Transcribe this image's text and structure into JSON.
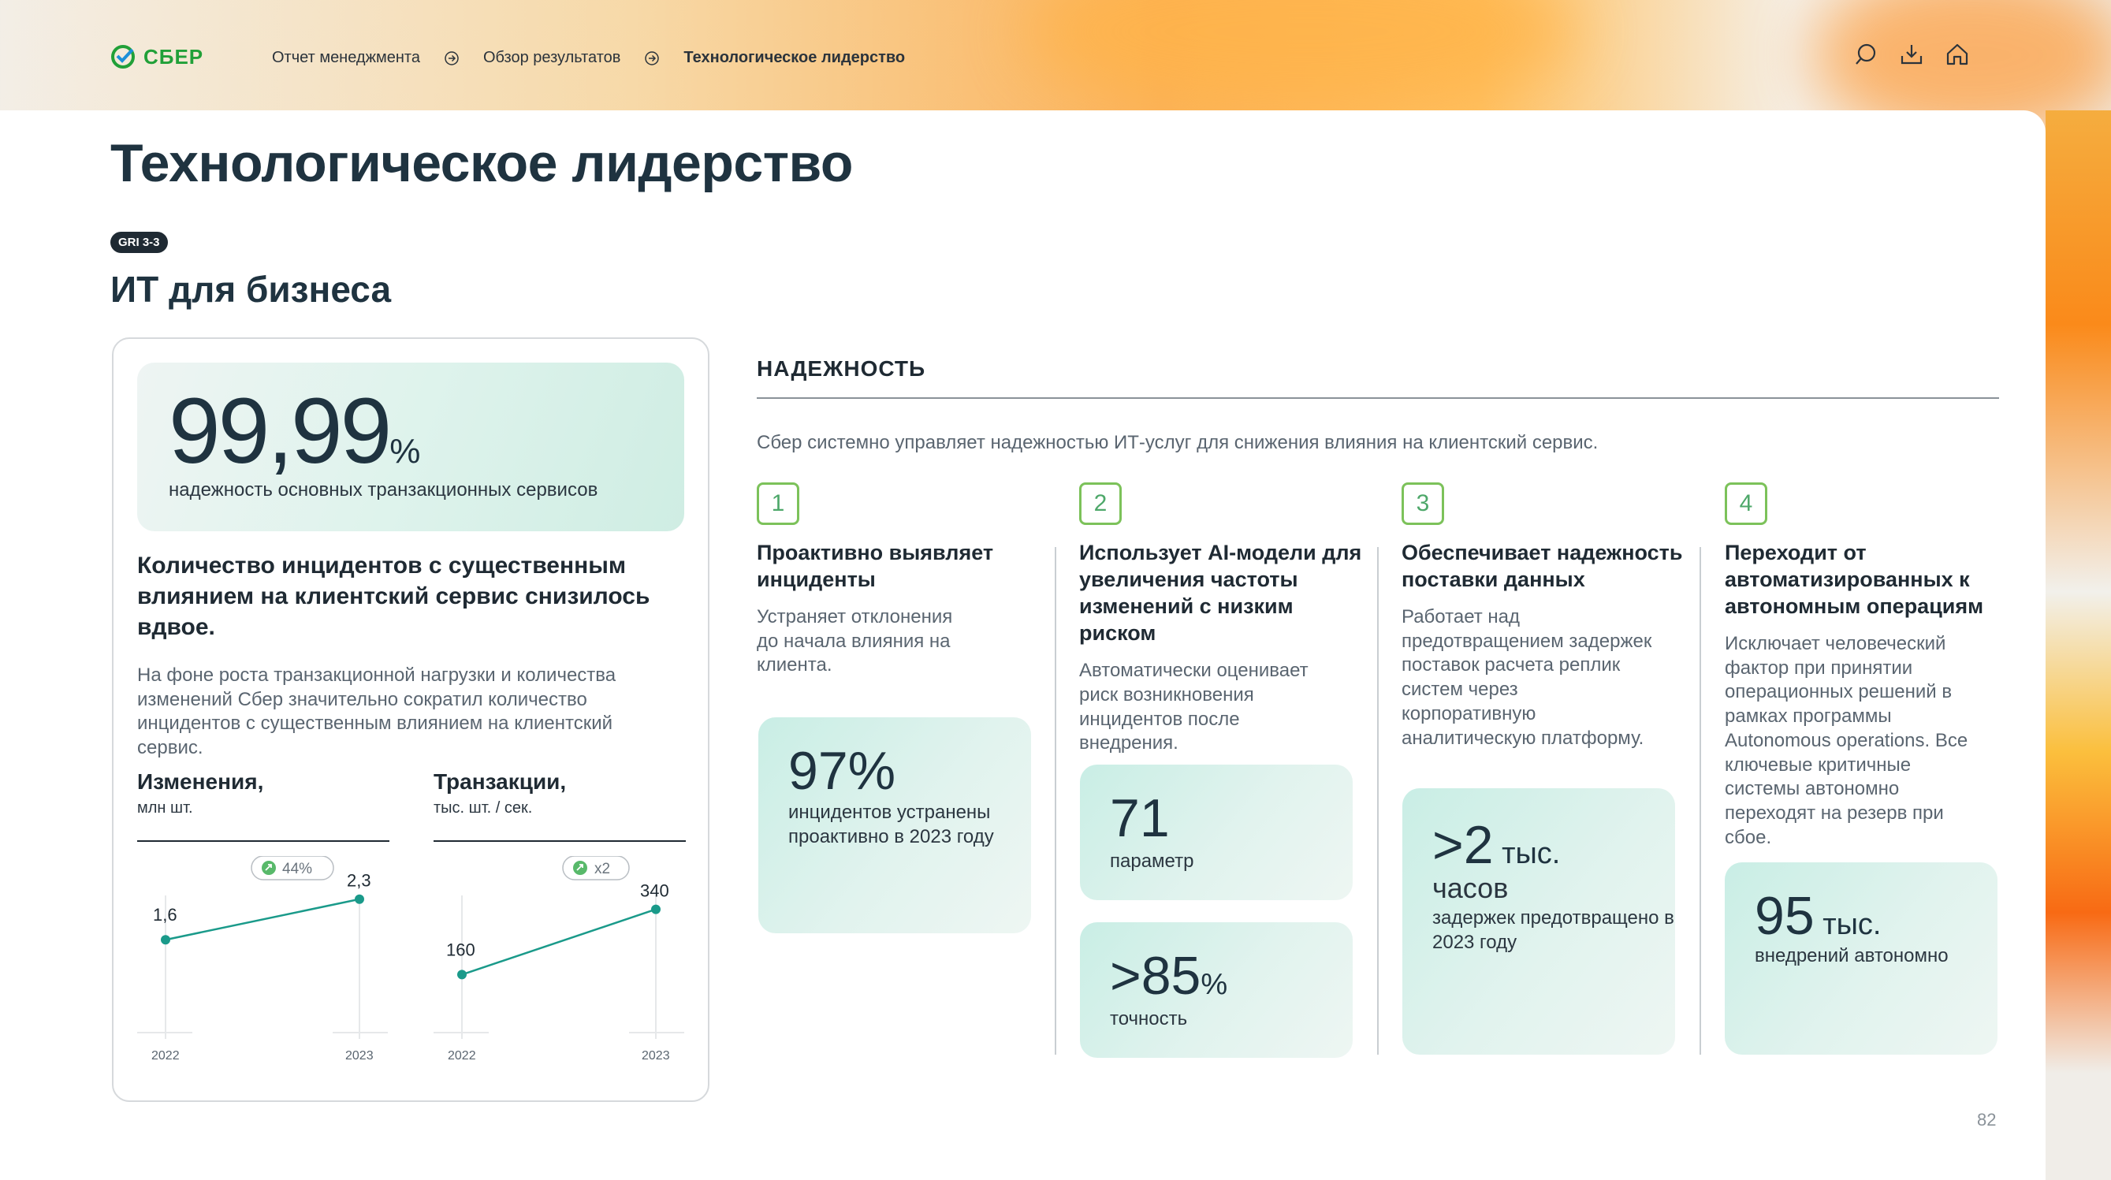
{
  "header": {
    "logo": "СБЕР",
    "breadcrumbs": [
      "Отчет менеджмента",
      "Обзор результатов",
      "Технологическое лидерство"
    ],
    "icons": [
      "search-icon",
      "download-icon",
      "home-icon"
    ]
  },
  "page": {
    "title": "Технологическое лидерство",
    "gri": "GRI 3-3",
    "subtitle": "ИТ для бизнеса",
    "number": "82"
  },
  "left": {
    "hero_value": "99,99",
    "hero_unit": "%",
    "hero_desc": "надежность основных транзакционных сервисов",
    "title": "Количество инцидентов с существенным влиянием на клиентский сервис снизилось вдвое.",
    "text": "На фоне роста транзакционной нагрузки и количества изменений Сбер значительно сократил количество инцидентов с существенным влиянием на клиентский сервис.",
    "charts": [
      {
        "title": "Изменения,",
        "unit": "млн шт.",
        "badge": "44%",
        "years": [
          "2022",
          "2023"
        ],
        "values": [
          "1,6",
          "2,3"
        ]
      },
      {
        "title": "Транзакции,",
        "unit": "тыс. шт. / сек.",
        "badge": "x2",
        "years": [
          "2022",
          "2023"
        ],
        "values": [
          "160",
          "340"
        ]
      }
    ]
  },
  "chart_data": [
    {
      "type": "line",
      "title": "Изменения,",
      "ylabel": "млн шт.",
      "categories": [
        "2022",
        "2023"
      ],
      "values": [
        1.6,
        2.3
      ],
      "annotation": "44%"
    },
    {
      "type": "line",
      "title": "Транзакции,",
      "ylabel": "тыс. шт. / сек.",
      "categories": [
        "2022",
        "2023"
      ],
      "values": [
        160,
        340
      ],
      "annotation": "x2"
    }
  ],
  "reliability": {
    "label": "НАДЕЖНОСТЬ",
    "intro": "Сбер системно управляет надежностью ИТ-услуг для снижения влияния на клиентский сервис.",
    "columns": [
      {
        "n": "1",
        "title": "Проактивно выявляет инциденты",
        "text": "Устраняет отклонения до начала влияния на клиента.",
        "stats": [
          {
            "big": "97%",
            "unit": "",
            "desc": "инцидентов устранены проактивно в 2023 году"
          }
        ]
      },
      {
        "n": "2",
        "title": "Использует AI-модели для увеличения частоты изменений с низким риском",
        "text": "Автоматически оценивает риск возникновения инцидентов после внедрения.",
        "stats": [
          {
            "big": "71",
            "unit": "",
            "desc": "параметр"
          },
          {
            "big": ">85",
            "unit": "%",
            "desc": "точность"
          }
        ]
      },
      {
        "n": "3",
        "title": "Обеспечивает надежность поставки данных",
        "text": "Работает над предотвращением задержек поставок расчета реплик систем через корпоративную аналитическую платформу.",
        "stats": [
          {
            "big": ">2",
            "unit": " тыс.",
            "big2": "часов",
            "desc": "задержек предотвращено в 2023 году"
          }
        ]
      },
      {
        "n": "4",
        "title": "Переходит от автоматизированных к автономным операциям",
        "text": "Исключает человеческий фактор при принятии операционных решений в рамках программы Autonomous operations. Все ключевые критичные системы автономно переходят на резерв при сбое.",
        "stats": [
          {
            "big": "95",
            "unit": " тыс.",
            "desc": "внедрений автономно"
          }
        ]
      }
    ]
  }
}
